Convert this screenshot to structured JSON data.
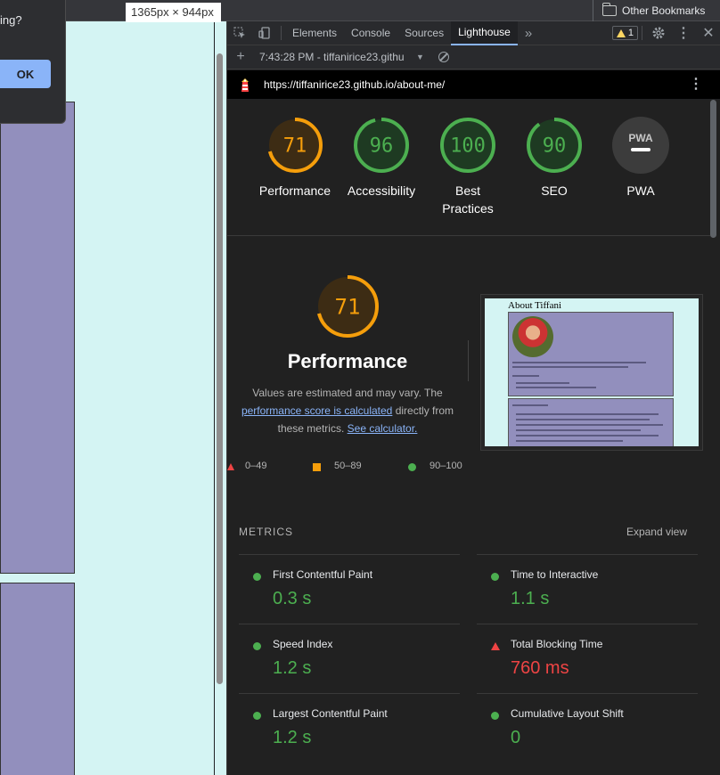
{
  "browser": {
    "bookmarks_label": "Other Bookmarks"
  },
  "viewport": {
    "dimensions_label": "1365px × 944px",
    "alert_text": "ing?",
    "alert_ok": "OK"
  },
  "devtools": {
    "tabs": [
      "Elements",
      "Console",
      "Sources",
      "Lighthouse"
    ],
    "active_tab": "Lighthouse",
    "more_tabs": "»",
    "warning_count": "1",
    "report_select": "7:43:28 PM - tiffanirice23.githu",
    "url": "https://tiffanirice23.github.io/about-me/"
  },
  "gauges": [
    {
      "score": "71",
      "label": "Performance",
      "value": 0.71,
      "color": "#f59e0b"
    },
    {
      "score": "96",
      "label": "Accessibility",
      "value": 0.96,
      "color": "#4caf50"
    },
    {
      "score": "100",
      "label": "Best Practices",
      "value": 1.0,
      "color": "#4caf50"
    },
    {
      "score": "90",
      "label": "SEO",
      "value": 0.9,
      "color": "#4caf50"
    },
    {
      "score": "PWA",
      "label": "PWA",
      "value": 0,
      "color": "#9aa0a6"
    }
  ],
  "performance": {
    "score": "71",
    "title": "Performance",
    "desc_1": "Values are estimated and may vary. The",
    "link_1": "performance score is calculated",
    "desc_2": "directly from these metrics.",
    "link_2": "See calculator.",
    "legend": [
      "0–49",
      "50–89",
      "90–100"
    ]
  },
  "screenshot": {
    "title": "About Tiffani"
  },
  "metrics": {
    "heading": "METRICS",
    "expand": "Expand view",
    "items": [
      {
        "title": "First Contentful Paint",
        "value": "0.3 s",
        "status": "good"
      },
      {
        "title": "Time to Interactive",
        "value": "1.1 s",
        "status": "good"
      },
      {
        "title": "Speed Index",
        "value": "1.2 s",
        "status": "good"
      },
      {
        "title": "Total Blocking Time",
        "value": "760 ms",
        "status": "poor"
      },
      {
        "title": "Largest Contentful Paint",
        "value": "1.2 s",
        "status": "good"
      },
      {
        "title": "Cumulative Layout Shift",
        "value": "0",
        "status": "good"
      }
    ]
  }
}
